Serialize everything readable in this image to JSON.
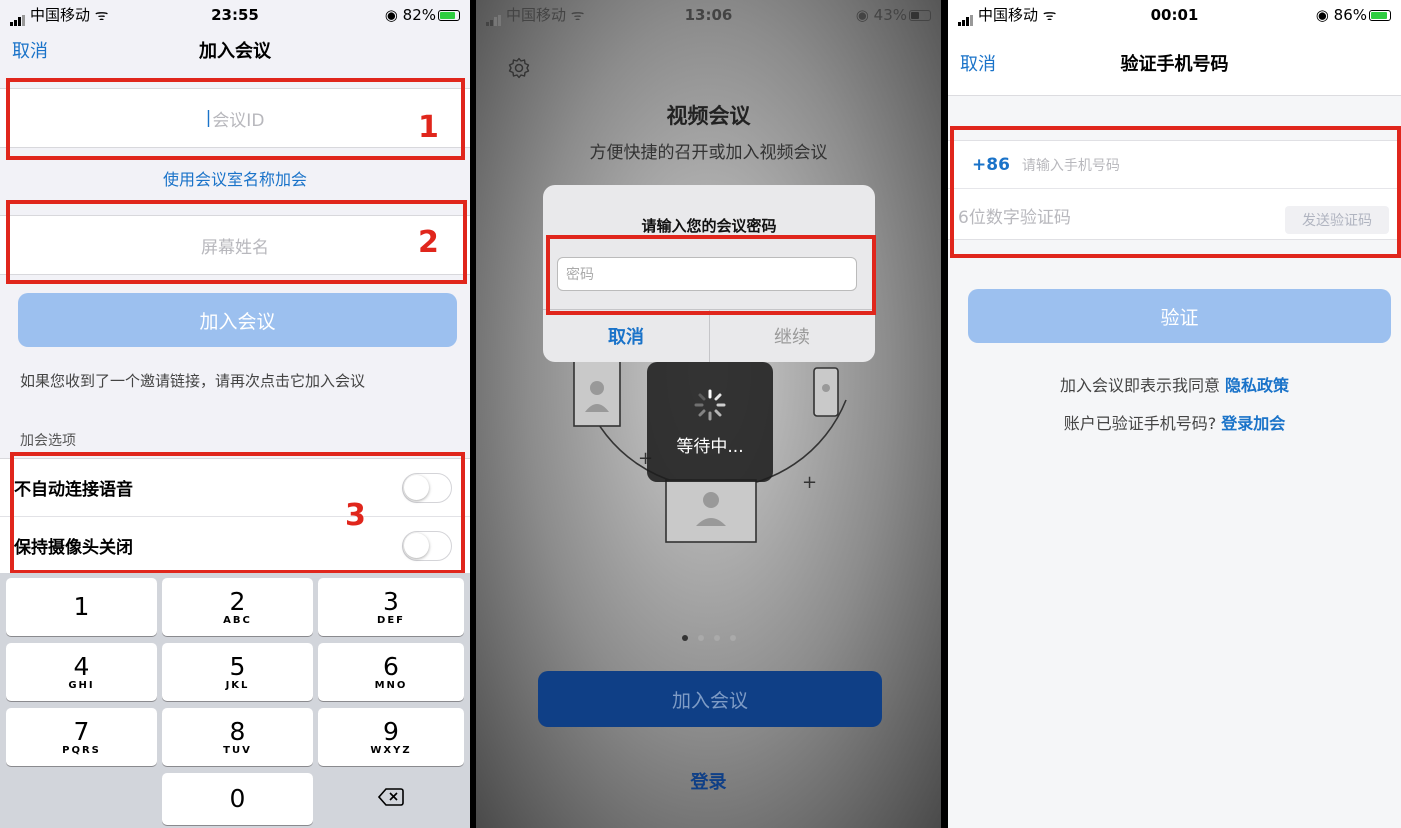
{
  "screen1": {
    "status": {
      "carrier": "中国移动",
      "time": "23:55",
      "battery": "82%"
    },
    "nav": {
      "cancel": "取消",
      "title": "加入会议"
    },
    "meeting_id_placeholder": "会议ID",
    "room_name_link": "使用会议室名称加会",
    "screen_name_placeholder": "屏幕姓名",
    "join_button": "加入会议",
    "hint": "如果您收到了一个邀请链接，请再次点击它加入会议",
    "options_header": "加会选项",
    "options": [
      {
        "label": "不自动连接语音",
        "on": false
      },
      {
        "label": "保持摄像头关闭",
        "on": false
      }
    ],
    "callouts": [
      "1",
      "2",
      "3"
    ],
    "keypad": [
      {
        "digit": "1",
        "letters": ""
      },
      {
        "digit": "2",
        "letters": "ABC"
      },
      {
        "digit": "3",
        "letters": "DEF"
      },
      {
        "digit": "4",
        "letters": "GHI"
      },
      {
        "digit": "5",
        "letters": "JKL"
      },
      {
        "digit": "6",
        "letters": "MNO"
      },
      {
        "digit": "7",
        "letters": "PQRS"
      },
      {
        "digit": "8",
        "letters": "TUV"
      },
      {
        "digit": "9",
        "letters": "WXYZ"
      },
      {
        "digit": "",
        "letters": ""
      },
      {
        "digit": "0",
        "letters": ""
      },
      {
        "digit": "⌫",
        "letters": ""
      }
    ]
  },
  "screen2": {
    "status": {
      "carrier": "中国移动",
      "time": "13:06",
      "battery": "43%"
    },
    "title": "视频会议",
    "subtitle": "方便快捷的召开或加入视频会议",
    "dialog": {
      "title": "请输入您的会议密码",
      "password_placeholder": "密码",
      "cancel": "取消",
      "continue": "继续"
    },
    "loading": "等待中...",
    "page_dots": 4,
    "active_dot": 0,
    "join_button": "加入会议",
    "login": "登录"
  },
  "screen3": {
    "status": {
      "carrier": "中国移动",
      "time": "00:01",
      "battery": "86%"
    },
    "nav": {
      "cancel": "取消",
      "title": "验证手机号码"
    },
    "country_code": "+86",
    "phone_placeholder": "请输入手机号码",
    "code_placeholder": "6位数字验证码",
    "send_code": "发送验证码",
    "verify_button": "验证",
    "agree_text": "加入会议即表示我同意",
    "privacy_link": "隐私政策",
    "verified_text": "账户已验证手机号码?",
    "login_link": "登录加会"
  },
  "colors": {
    "accent": "#1a73c9",
    "highlight": "#e0261c",
    "button_disabled": "#9cc0ef",
    "dark_button": "#0f3f86"
  },
  "icons": [
    "signal-icon",
    "wifi-icon",
    "battery-icon",
    "settings-gear-icon",
    "delete-key-icon",
    "spinner-icon"
  ]
}
